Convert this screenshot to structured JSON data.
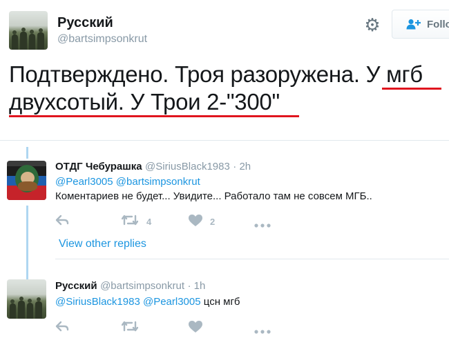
{
  "header": {
    "name": "Русский",
    "handle": "@bartsimpsonkrut",
    "follow_label": "Follo",
    "icons": {
      "settings": "gear-icon",
      "follow": "add-user-icon"
    }
  },
  "tweet": {
    "line1": "Подтверждено. Троя разоружена. У мгб",
    "line2": "двухсотый. У Трои 2-\"300\"",
    "annotation_color": "#e0141e"
  },
  "replies": [
    {
      "name": "ОТДГ Чебурашка",
      "handle": "@SiriusBlack1983",
      "time": "· 2h",
      "mention1": "@Pearl3005",
      "mention2": "@bartsimpsonkrut",
      "text": "Коментариев не будет... Увидите... Работало там не совсем МГБ..",
      "retweets": "4",
      "likes": "2"
    },
    {
      "name": "Русский",
      "handle": "@bartsimpsonkrut",
      "time": "· 1h",
      "mention1": "@SiriusBlack1983",
      "mention2": "@Pearl3005",
      "text": "цсн мгб"
    }
  ],
  "view_other_replies": "View other replies",
  "colors": {
    "link": "#1b95e0",
    "muted": "#8899a6",
    "thread": "#aed6f1"
  }
}
